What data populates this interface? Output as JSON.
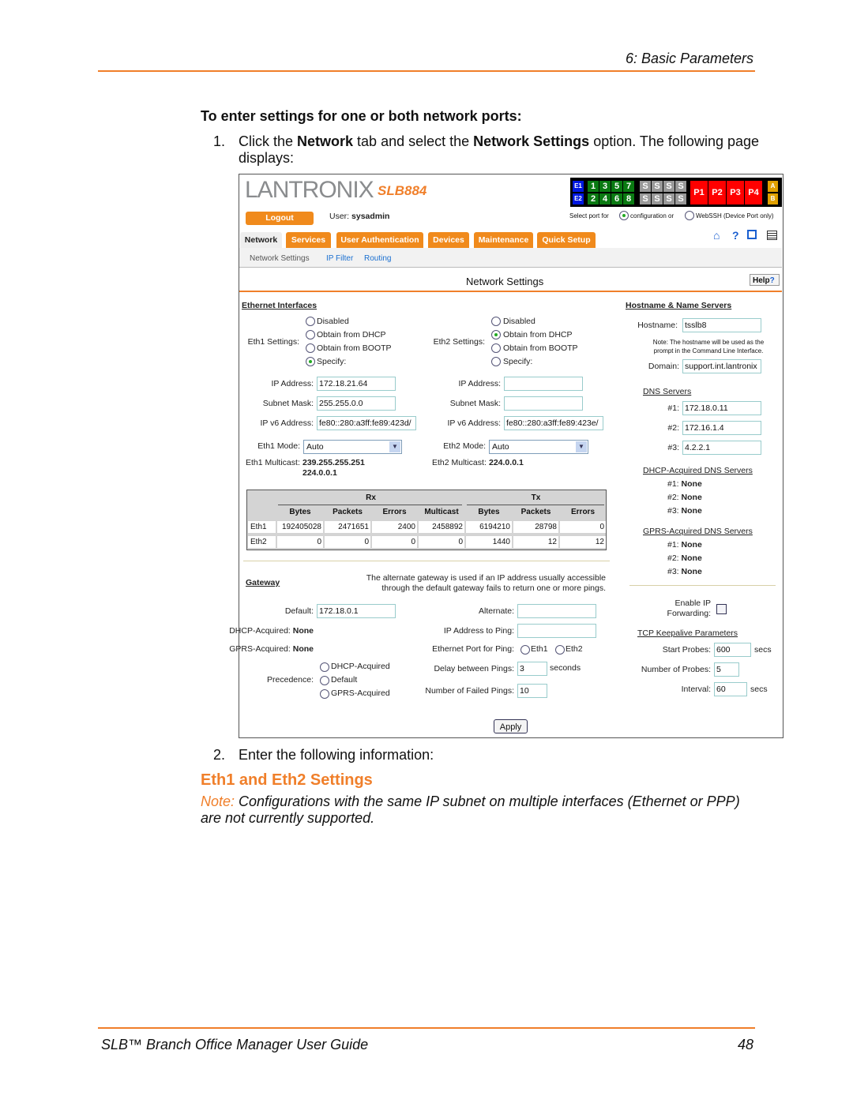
{
  "doc": {
    "header": "6: Basic Parameters",
    "heading": "To enter settings for one or both network ports:",
    "step1_num": "1.",
    "step1_a": "Click the ",
    "step1_b": "Network",
    "step1_c": " tab and select the ",
    "step1_d": "Network Settings",
    "step1_e": " option. The following page",
    "step1_f": "displays:",
    "step2_num": "2.",
    "step2": "Enter the following information:",
    "section": "Eth1 and Eth2 Settings",
    "note_label": "Note:",
    "note_1": " Configurations with the same IP subnet on multiple interfaces (Ethernet or PPP)",
    "note_2": "are not currently supported.",
    "footer_title": "SLB™ Branch Office Manager User Guide",
    "page_number": "48",
    "accent": "#f07f2a"
  },
  "ui": {
    "logo": "LANTRONIX",
    "model": "SLB884",
    "ports": {
      "e": [
        "E1",
        "E2"
      ],
      "top": [
        "1",
        "3",
        "5",
        "7"
      ],
      "bottom": [
        "2",
        "4",
        "6",
        "8"
      ],
      "s": "S",
      "p": [
        "P1",
        "P2",
        "P3",
        "P4"
      ],
      "ab": [
        "A",
        "B"
      ]
    },
    "logout": "Logout",
    "user_label": "User:",
    "user": "sysadmin",
    "select_port": "Select port for",
    "config": "configuration or",
    "webssh": "WebSSH (Device Port only)",
    "tabs": [
      "Network",
      "Services",
      "User Authentication",
      "Devices",
      "Maintenance",
      "Quick Setup"
    ],
    "icons": [
      "home-icon",
      "help-icon",
      "sitemap-icon",
      "log-icon"
    ],
    "help_glyph": "?",
    "subnav": [
      "Network Settings",
      "IP Filter",
      "Routing"
    ],
    "title": "Network Settings",
    "help": "Help",
    "eth": {
      "heading": "Ethernet Interfaces",
      "options": [
        "Disabled",
        "Obtain from DHCP",
        "Obtain from BOOTP",
        "Specify:"
      ],
      "eth1_label": "Eth1 Settings:",
      "eth2_label": "Eth2 Settings:",
      "eth1_selected": "Specify:",
      "eth2_selected": "Obtain from DHCP",
      "ip_label": "IP Address:",
      "mask_label": "Subnet Mask:",
      "ipv6_label": "IP v6 Address:",
      "eth1_ip": "172.18.21.64",
      "eth1_mask": "255.255.0.0",
      "eth1_ipv6": "fe80::280:a3ff:fe89:423d/",
      "eth2_ip": "",
      "eth2_mask": "",
      "eth2_ipv6": "fe80::280:a3ff:fe89:423e/",
      "eth1_mode_label": "Eth1 Mode:",
      "eth2_mode_label": "Eth2 Mode:",
      "eth1_mode": "Auto",
      "eth2_mode": "Auto",
      "eth1_mc_label": "Eth1 Multicast:",
      "eth1_mc": [
        "239.255.255.251",
        "224.0.0.1"
      ],
      "eth2_mc_label": "Eth2 Multicast:",
      "eth2_mc": "224.0.0.1"
    },
    "stats": {
      "rx": "Rx",
      "tx": "Tx",
      "columns": [
        "Bytes",
        "Packets",
        "Errors",
        "Multicast",
        "Bytes",
        "Packets",
        "Errors"
      ],
      "rows": [
        {
          "name": "Eth1",
          "values": [
            "192405028",
            "2471651",
            "2400",
            "2458892",
            "6194210",
            "28798",
            "0"
          ]
        },
        {
          "name": "Eth2",
          "values": [
            "0",
            "0",
            "0",
            "0",
            "1440",
            "12",
            "12"
          ]
        }
      ]
    },
    "gw": {
      "heading": "Gateway",
      "note": [
        "The alternate gateway is used if an IP address usually accessible",
        "through the default gateway fails to return one or more pings."
      ],
      "default_label": "Default:",
      "default": "172.18.0.1",
      "dhcp_label": "DHCP-Acquired:",
      "dhcp": "None",
      "gprs_label": "GPRS-Acquired:",
      "gprs": "None",
      "prec_label": "Precedence:",
      "prec_options": [
        "DHCP-Acquired",
        "Default",
        "GPRS-Acquired"
      ],
      "alt_label": "Alternate:",
      "alt": "",
      "ping_label": "IP Address to Ping:",
      "ping": "",
      "port_label": "Ethernet Port for Ping:",
      "port_options": [
        "Eth1",
        "Eth2"
      ],
      "delay_label": "Delay between Pings:",
      "delay": "3",
      "delay_unit": "seconds",
      "failed_label": "Number of Failed Pings:",
      "failed": "10"
    },
    "host": {
      "heading": "Hostname & Name Servers",
      "hostname_label": "Hostname:",
      "hostname": "tsslb8",
      "note": [
        "Note: The hostname will be used as the",
        "prompt in the Command Line Interface."
      ],
      "domain_label": "Domain:",
      "domain": "support.int.lantronix",
      "dns_heading": "DNS Servers",
      "dns_labels": [
        "#1:",
        "#2:",
        "#3:"
      ],
      "dns": [
        "172.18.0.11",
        "172.16.1.4",
        "4.2.2.1"
      ],
      "dhcp_heading": "DHCP-Acquired DNS Servers",
      "dhcp_dns": [
        "None",
        "None",
        "None"
      ],
      "gprs_heading": "GPRS-Acquired DNS Servers",
      "gprs_dns": [
        "None",
        "None",
        "None"
      ],
      "fwd_label": [
        "Enable IP",
        "Forwarding:"
      ],
      "fwd_checked": false,
      "tcp_heading": "TCP Keepalive Parameters",
      "start_label": "Start Probes:",
      "start": "600",
      "num_label": "Number of Probes:",
      "num": "5",
      "interval_label": "Interval:",
      "interval": "60",
      "secs": "secs"
    },
    "apply": "Apply"
  }
}
